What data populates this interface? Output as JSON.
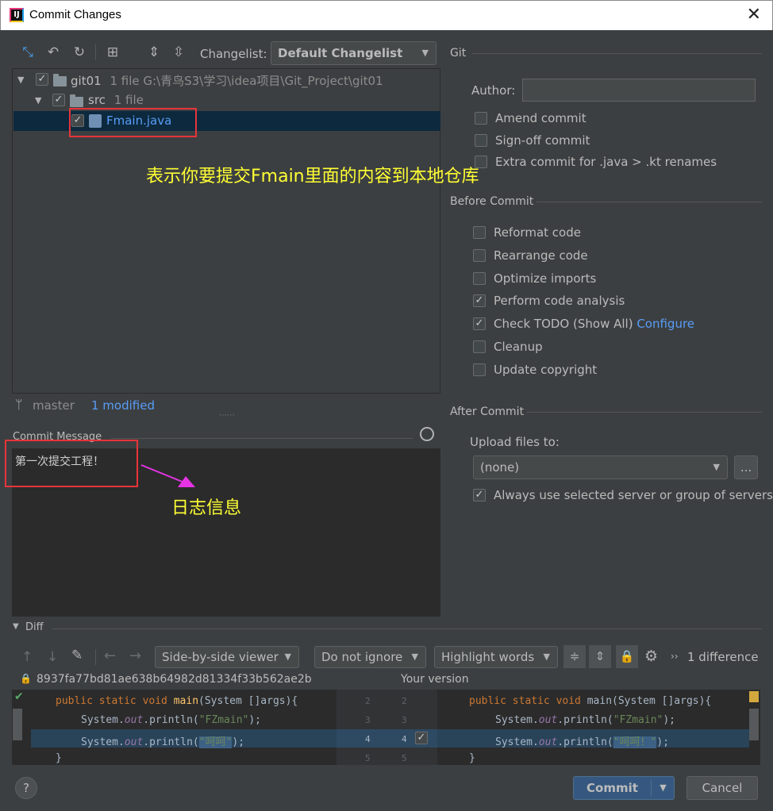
{
  "window": {
    "title": "Commit Changes",
    "app_icon": "IJ"
  },
  "toolbar": {
    "changelist_label": "Changelist:",
    "changelist_value": "Default Changelist",
    "git_label": "Git"
  },
  "tree": {
    "root": {
      "name": "git01",
      "info": "1 file  G:\\青鸟S3\\学习\\idea项目\\Git_Project\\git01"
    },
    "folder": {
      "name": "src",
      "info": "1 file"
    },
    "file": {
      "name": "Fmain.java"
    }
  },
  "annotations": {
    "tree_note": "表示你要提交Fmain里面的内容到本地仓库",
    "message_note": "日志信息"
  },
  "status": {
    "branch": "master",
    "modified": "1 modified"
  },
  "commit_message": {
    "label": "Commit Message",
    "value": "第一次提交工程！"
  },
  "git": {
    "author_label": "Author:",
    "author_value": "",
    "options": [
      {
        "label": "Amend commit",
        "checked": false
      },
      {
        "label": "Sign-off commit",
        "checked": false
      },
      {
        "label": "Extra commit for .java > .kt renames",
        "checked": false
      }
    ]
  },
  "before_commit": {
    "title": "Before Commit",
    "options": [
      {
        "label": "Reformat code",
        "checked": false
      },
      {
        "label": "Rearrange code",
        "checked": false
      },
      {
        "label": "Optimize imports",
        "checked": false
      },
      {
        "label": "Perform code analysis",
        "checked": true
      },
      {
        "label": "Check TODO (Show All)",
        "checked": true,
        "link": "Configure"
      },
      {
        "label": "Cleanup",
        "checked": false
      },
      {
        "label": "Update copyright",
        "checked": false
      }
    ]
  },
  "after_commit": {
    "title": "After Commit",
    "upload_label": "Upload files to:",
    "upload_value": "(none)",
    "browse_label": "...",
    "always_use_label": "Always use selected server or group of servers",
    "always_use_checked": true
  },
  "diff": {
    "title": "Diff",
    "viewer": "Side-by-side viewer",
    "ignore": "Do not ignore",
    "highlight": "Highlight words",
    "difference_count": "1 difference",
    "left_revision": "8937fa77bd81ae638b64982d81334f33b562ae2b",
    "right_title": "Your version",
    "line_numbers": [
      [
        "2",
        "2"
      ],
      [
        "3",
        "3"
      ],
      [
        "4",
        "4"
      ],
      [
        "5",
        "5"
      ]
    ],
    "left_strings": [
      "\"FZmain\"",
      "\"呵呵\""
    ],
    "right_strings": [
      "\"FZmain\"",
      "\"呵呵！\""
    ]
  },
  "footer": {
    "help": "?",
    "commit": "Commit",
    "cancel": "Cancel"
  },
  "colors": {
    "accent": "#589df6",
    "annotation": "#ffff33",
    "highlight_box": "#e8343a",
    "arrow": "#e633e6"
  }
}
